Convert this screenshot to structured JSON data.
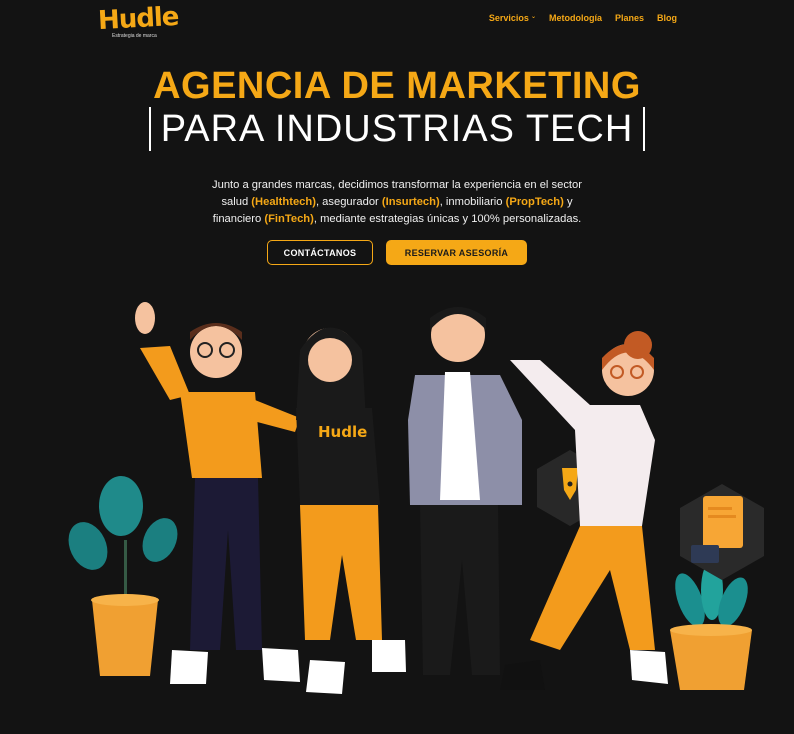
{
  "brand": {
    "logo_text": "Hudle",
    "tagline": "Estrategia de marca"
  },
  "nav": {
    "items": [
      {
        "label": "Servicios",
        "has_dropdown": true
      },
      {
        "label": "Metodología"
      },
      {
        "label": "Planes"
      },
      {
        "label": "Blog"
      }
    ]
  },
  "hero": {
    "title_line1": "AGENCIA DE MARKETING",
    "title_line2": "PARA INDUSTRIAS TECH",
    "intro": {
      "t1": "Junto a grandes marcas, decidimos transformar la experiencia en el sector salud ",
      "h1": "(Healthtech)",
      "t2": ", asegurador ",
      "h2": "(Insurtech)",
      "t3": ", inmobiliario ",
      "h3": "(PropTech)",
      "t4": " y financiero ",
      "h4": "(FinTech)",
      "t5": ", mediante estrategias únicas y 100% personalizadas."
    },
    "cta_primary": "CONTÁCTANOS",
    "cta_secondary": "RESERVAR ASESORÍA",
    "shirt_text": "Hudle"
  },
  "colors": {
    "accent": "#f5a816",
    "background": "#131313"
  }
}
